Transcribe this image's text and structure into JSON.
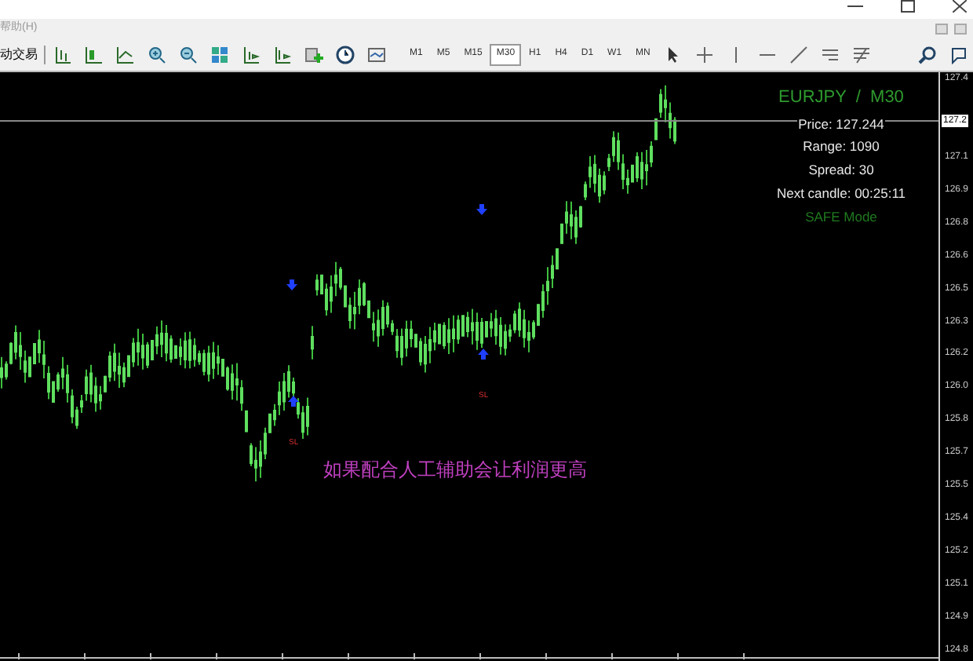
{
  "menu_bar": {
    "items": [
      "帮助(H)"
    ]
  },
  "toolbar": {
    "autotrade_label": "动交易",
    "timeframes": [
      {
        "label": "M1",
        "selected": false
      },
      {
        "label": "M5",
        "selected": false
      },
      {
        "label": "M15",
        "selected": false
      },
      {
        "label": "M30",
        "selected": true
      },
      {
        "label": "H1",
        "selected": false
      },
      {
        "label": "H4",
        "selected": false
      },
      {
        "label": "D1",
        "selected": false
      },
      {
        "label": "W1",
        "selected": false
      },
      {
        "label": "MN",
        "selected": false
      }
    ]
  },
  "info_panel": {
    "title": "EURJPY  /  M30",
    "lines": [
      "Price: 127.244",
      "Range: 1090",
      "Spread: 30",
      "Next candle: 00:25:11"
    ],
    "mode": "SAFE Mode"
  },
  "chart": {
    "caption": "如果配合人工辅助会让利润更高",
    "signals": [
      {
        "kind": "buy",
        "label": "SL"
      },
      {
        "kind": "buy",
        "label": "SL"
      },
      {
        "kind": "sell"
      },
      {
        "kind": "sell"
      }
    ],
    "price_axis": {
      "current": "127.2",
      "labels": [
        "127.4",
        "127.1",
        "126.9",
        "126.8",
        "126.6",
        "126.5",
        "126.3",
        "126.2",
        "126.0",
        "125.8",
        "125.7",
        "125.5",
        "125.4",
        "125.2",
        "125.1",
        "124.9",
        "124.8"
      ]
    }
  }
}
